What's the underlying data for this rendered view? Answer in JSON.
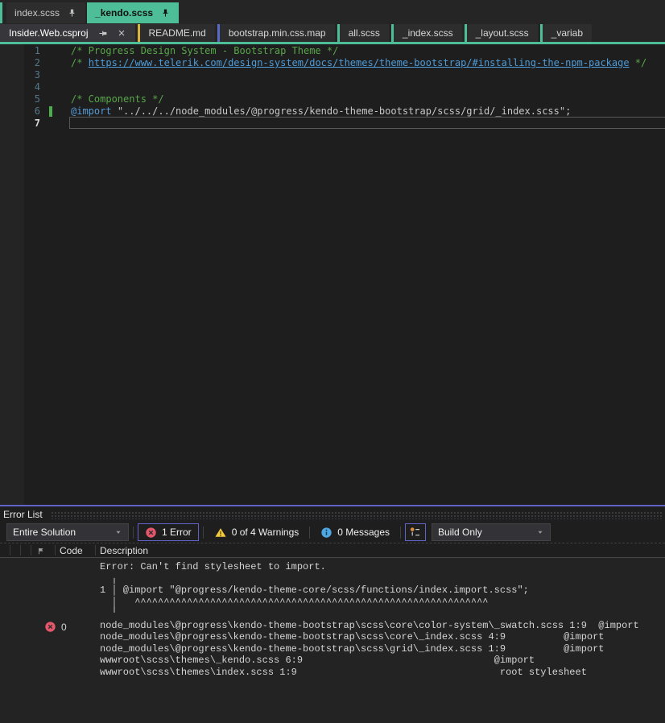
{
  "colors": {
    "active_tab_green": "#4dbe98",
    "readme_accent_yellow": "#d9b33c",
    "map_accent_blue": "#5a6bc5",
    "panel_accent_purple": "#6163c8",
    "error_red": "#e5566a",
    "warning_yellow": "#f2cc3d",
    "info_blue": "#4fa7e0",
    "change_bar_green": "#4cae4c"
  },
  "tab_rows": {
    "row1": [
      {
        "label": "index.scss",
        "pinned": true,
        "active": false
      },
      {
        "label": "_kendo.scss",
        "pinned": true,
        "active": true
      }
    ],
    "row2": [
      {
        "label": "Insider.Web.csproj",
        "selected": true,
        "pinned": true,
        "closable": true,
        "accent": ""
      },
      {
        "label": "README.md",
        "accent": "#d9b33c"
      },
      {
        "label": "bootstrap.min.css.map",
        "accent": "#5a6bc5"
      },
      {
        "label": "all.scss",
        "accent": "#4dbe98"
      },
      {
        "label": "_index.scss",
        "accent": "#4dbe98"
      },
      {
        "label": "_layout.scss",
        "accent": "#4dbe98"
      },
      {
        "label": "_variab",
        "accent": "#4dbe98"
      }
    ]
  },
  "editor": {
    "lines": [
      {
        "n": 1,
        "tokens": [
          {
            "t": "/* Progress Design System - Bootstrap Theme */",
            "c": "comment"
          }
        ]
      },
      {
        "n": 2,
        "tokens": [
          {
            "t": "/* ",
            "c": "comment"
          },
          {
            "t": "https://www.telerik.com/design-system/docs/themes/theme-bootstrap/#installing-the-npm-package",
            "c": "link"
          },
          {
            "t": " */",
            "c": "comment"
          }
        ]
      },
      {
        "n": 3,
        "tokens": []
      },
      {
        "n": 4,
        "tokens": []
      },
      {
        "n": 5,
        "tokens": [
          {
            "t": "/* Components */",
            "c": "comment"
          }
        ]
      },
      {
        "n": 6,
        "changed": true,
        "tokens": [
          {
            "t": "@import",
            "c": "keyword"
          },
          {
            "t": " ",
            "c": "plain"
          },
          {
            "t": "\"../../../node_modules/@progress/kendo-theme-bootstrap/scss/grid/_index.scss\";",
            "c": "string"
          }
        ]
      },
      {
        "n": 7,
        "current": true,
        "tokens": []
      }
    ]
  },
  "error_list": {
    "title": "Error List",
    "toolbar": {
      "scope": "Entire Solution",
      "errors": "1 Error",
      "warnings": "0 of 4 Warnings",
      "messages": "0 Messages",
      "filter": "Build Only"
    },
    "columns": {
      "code": "Code",
      "description": "Description"
    },
    "rows": [
      {
        "severity": "error",
        "code": "0",
        "description_lines": [
          "Error: Can't find stylesheet to import.",
          "  ╷",
          "1 │ @import \"@progress/kendo-theme-core/scss/functions/index.import.scss\";",
          "  │   ^^^^^^^^^^^^^^^^^^^^^^^^^^^^^^^^^^^^^^^^^^^^^^^^^^^^^^^^^^^^^",
          "  ╵",
          "node_modules\\@progress\\kendo-theme-bootstrap\\scss\\core\\color-system\\_swatch.scss 1:9  @import",
          "node_modules\\@progress\\kendo-theme-bootstrap\\scss\\core\\_index.scss 4:9          @import",
          "node_modules\\@progress\\kendo-theme-bootstrap\\scss\\grid\\_index.scss 1:9          @import",
          "wwwroot\\scss\\themes\\_kendo.scss 6:9                                 @import",
          "wwwroot\\scss\\themes\\index.scss 1:9                                   root stylesheet"
        ]
      }
    ]
  },
  "icons": {
    "pin": "pin-icon",
    "close": "close-icon",
    "dropdown": "chevron-down-icon",
    "error": "error-icon",
    "warning": "warning-icon",
    "info": "info-icon",
    "details_toggle": "details-toggle-icon",
    "severity_column": "severity-column-icon"
  }
}
